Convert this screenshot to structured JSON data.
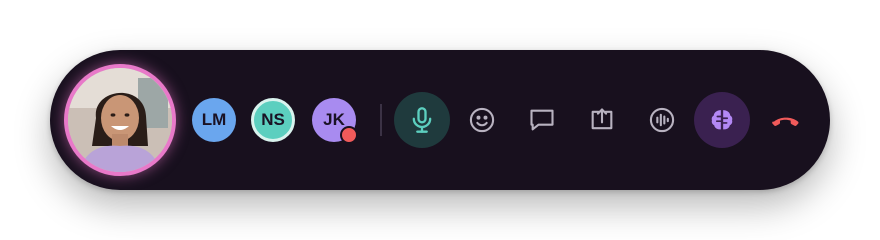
{
  "self": {
    "icon": "user-video-thumbnail",
    "ring_color": "#e879c9"
  },
  "participants": [
    {
      "initials": "LM",
      "color": "#6aa6ee"
    },
    {
      "initials": "NS",
      "color": "#5ccfbf"
    },
    {
      "initials": "JK",
      "color": "#a88bf0",
      "status_color": "#f05a5a"
    }
  ],
  "controls": {
    "mic": {
      "icon": "microphone-icon",
      "state": "on",
      "color": "#5ccfbf"
    },
    "reactions": {
      "icon": "smiley-icon"
    },
    "chat": {
      "icon": "chat-bubble-icon"
    },
    "share": {
      "icon": "share-screen-icon"
    },
    "audio": {
      "icon": "audio-waveform-icon"
    },
    "ai": {
      "icon": "brain-icon",
      "color": "#b388f5"
    },
    "hangup": {
      "icon": "phone-hangup-icon",
      "color": "#f05a5a"
    }
  }
}
